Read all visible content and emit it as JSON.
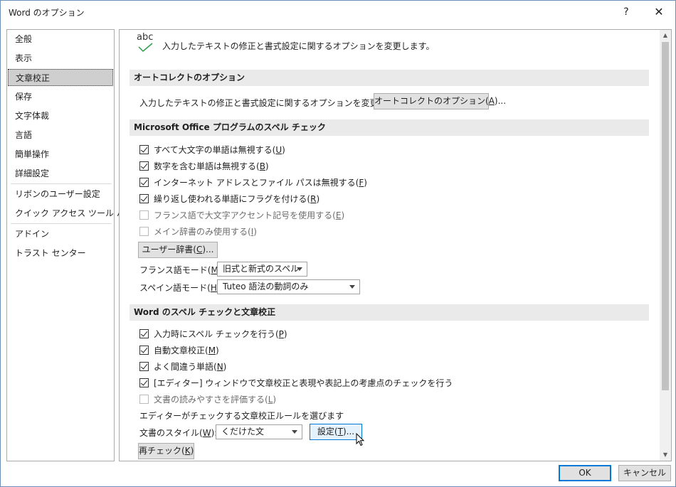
{
  "window": {
    "title": "Word のオプション",
    "help_label": "?",
    "close_label": "✕"
  },
  "nav": {
    "items": [
      {
        "label": "全般"
      },
      {
        "label": "表示"
      },
      {
        "label": "文章校正",
        "selected": true
      },
      {
        "label": "保存"
      },
      {
        "label": "文字体裁"
      },
      {
        "label": "言語"
      },
      {
        "label": "簡単操作"
      },
      {
        "label": "詳細設定"
      },
      {
        "label": "リボンのユーザー設定"
      },
      {
        "label": "クイック アクセス ツール バー"
      },
      {
        "label": "アドイン"
      },
      {
        "label": "トラスト センター"
      }
    ]
  },
  "header": {
    "icon_text": "abc",
    "description": "入力したテキストの修正と書式設定に関するオプションを変更します。"
  },
  "autocorrect": {
    "heading": "オートコレクトのオプション",
    "text": "入力したテキストの修正と書式設定に関するオプションを変更します。",
    "button_pre": "オートコレクトのオプション(",
    "button_key": "A",
    "button_post": ")..."
  },
  "spell": {
    "heading": "Microsoft Office プログラムのスペル チェック",
    "options": [
      {
        "pre": "すべて大文字の単語は無視する(",
        "key": "U",
        "post": ")",
        "checked": true
      },
      {
        "pre": "数字を含む単語は無視する(",
        "key": "B",
        "post": ")",
        "checked": true
      },
      {
        "pre": "インターネット アドレスとファイル パスは無視する(",
        "key": "F",
        "post": ")",
        "checked": true
      },
      {
        "pre": "繰り返し使われる単語にフラグを付ける(",
        "key": "R",
        "post": ")",
        "checked": true
      },
      {
        "pre": "フランス語で大文字アクセント記号を使用する(",
        "key": "E",
        "post": ")",
        "checked": false
      },
      {
        "pre": "メイン辞書のみ使用する(",
        "key": "I",
        "post": ")",
        "checked": false
      }
    ],
    "dict_button_pre": "ユーザー辞書(",
    "dict_button_key": "C",
    "dict_button_post": ")...",
    "french_label_pre": "フランス語モード(",
    "french_label_key": "M",
    "french_label_post": "):",
    "french_value": "旧式と新式のスペル",
    "spanish_label_pre": "スペイン語モード(",
    "spanish_label_key": "H",
    "spanish_label_post": "):",
    "spanish_value": "Tuteo 語法の動詞のみ"
  },
  "grammar": {
    "heading": "Word のスペル チェックと文章校正",
    "options": [
      {
        "pre": "入力時にスペル チェックを行う(",
        "key": "P",
        "post": ")",
        "checked": true
      },
      {
        "pre": "自動文章校正(",
        "key": "M",
        "post": ")",
        "checked": true
      },
      {
        "pre": "よく間違う単語(",
        "key": "N",
        "post": ")",
        "checked": true
      },
      {
        "pre": "[エディター] ウィンドウで文章校正と表現や表記上の考慮点のチェックを行う",
        "key": "",
        "post": "",
        "checked": true
      },
      {
        "pre": "文書の読みやすさを評価する(",
        "key": "L",
        "post": ")",
        "checked": false
      }
    ],
    "rules_text": "エディターがチェックする文章校正ルールを選びます",
    "style_label_pre": "文書のスタイル(",
    "style_label_key": "W",
    "style_label_post": "):",
    "style_value": "くだけた文",
    "settings_pre": "設定(",
    "settings_key": "T",
    "settings_post": ")...",
    "recheck_pre": "再チェック(",
    "recheck_key": "K",
    "recheck_post": ")"
  },
  "footer": {
    "ok": "OK",
    "cancel": "キャンセル"
  },
  "colors": {
    "accent": "#0078d7",
    "section_bg": "#eaeaea",
    "check_icon": "#2e9e4f"
  }
}
